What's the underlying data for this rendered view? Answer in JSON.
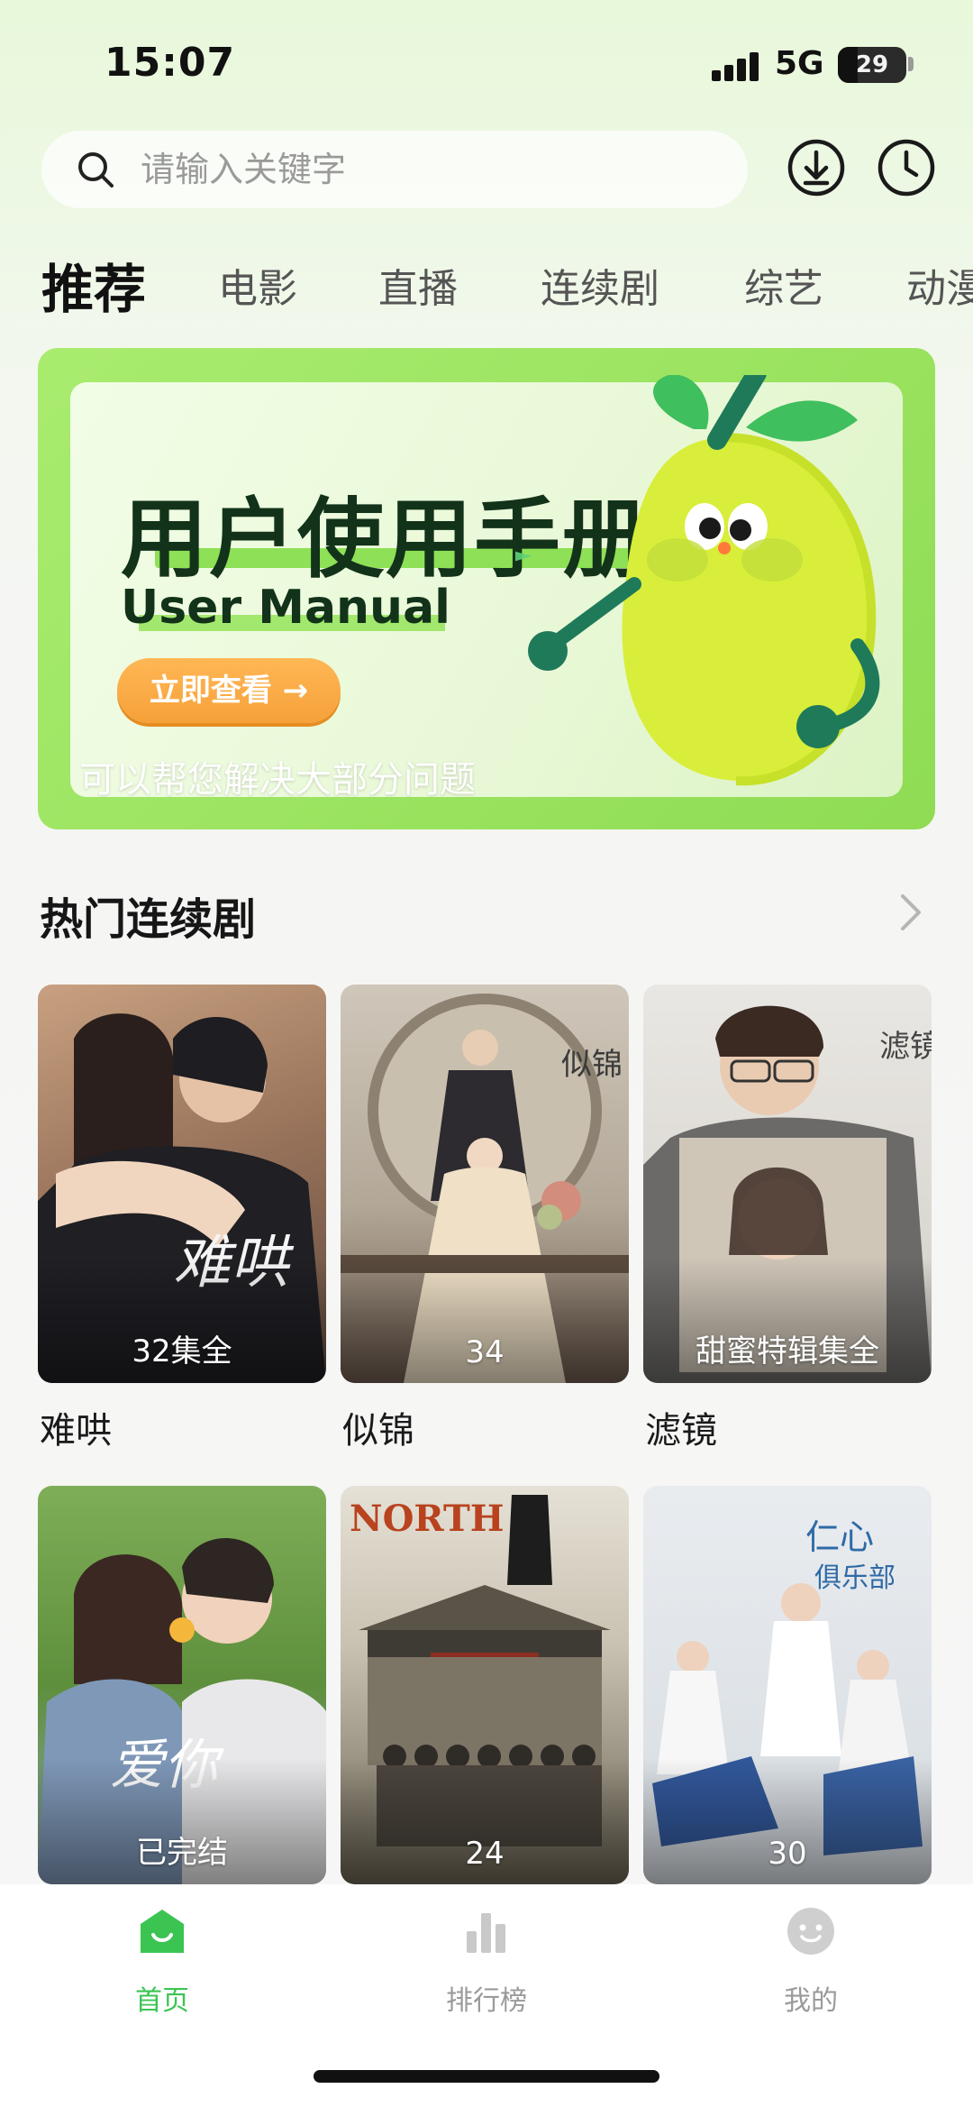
{
  "status_bar": {
    "time": "15:07",
    "network": "5G",
    "battery_level": "29",
    "battery_fraction": 0.29
  },
  "search": {
    "placeholder": "请输入关键字",
    "value": ""
  },
  "header_icons": [
    "download-icon",
    "history-icon"
  ],
  "tabs": [
    {
      "label": "推荐",
      "active": true
    },
    {
      "label": "电影",
      "active": false
    },
    {
      "label": "直播",
      "active": false
    },
    {
      "label": "连续剧",
      "active": false
    },
    {
      "label": "综艺",
      "active": false
    },
    {
      "label": "动漫",
      "active": false
    }
  ],
  "banner": {
    "title": "用户使用手册",
    "subtitle": "User Manual",
    "button": "立即查看 →",
    "caption": "可以帮您解决大部分问题"
  },
  "section": {
    "title": "热门连续剧",
    "more_icon": "chevron-right-icon"
  },
  "dramas": [
    {
      "name": "难哄",
      "badge": "32集全"
    },
    {
      "name": "似锦",
      "badge": "34"
    },
    {
      "name": "滤镜",
      "badge": "甜蜜特辑集全"
    },
    {
      "name": "",
      "badge": "已完结"
    },
    {
      "name": "",
      "badge": "24"
    },
    {
      "name": "",
      "badge": "30"
    }
  ],
  "bottom_nav": [
    {
      "label": "首页",
      "icon": "home-icon",
      "active": true
    },
    {
      "label": "排行榜",
      "icon": "chart-icon",
      "active": false
    },
    {
      "label": "我的",
      "icon": "profile-icon",
      "active": false
    }
  ],
  "colors": {
    "accent": "#3cc452",
    "banner_green": "#a9ec6f",
    "button_orange": "#f6a13a"
  }
}
